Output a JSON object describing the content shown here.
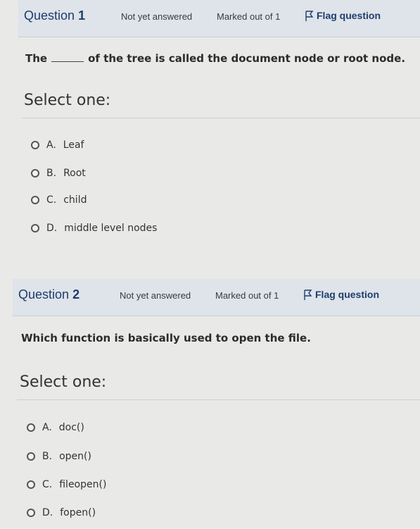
{
  "questions": [
    {
      "number_prefix": "Question",
      "number": "1",
      "status": "Not yet answered",
      "marks": "Marked out of 1",
      "flag_label": "Flag question",
      "text_before": "The",
      "text_after": "of the tree is called the document node or root node.",
      "select_label": "Select one:",
      "options": [
        {
          "letter": "A.",
          "text": "Leaf"
        },
        {
          "letter": "B.",
          "text": "Root"
        },
        {
          "letter": "C.",
          "text": "child"
        },
        {
          "letter": "D.",
          "text": "middle level nodes"
        }
      ]
    },
    {
      "number_prefix": "Question",
      "number": "2",
      "status": "Not yet answered",
      "marks": "Marked out of 1",
      "flag_label": "Flag question",
      "text": "Which function is basically used to open the file.",
      "select_label": "Select one:",
      "options": [
        {
          "letter": "A.",
          "text": "doc()"
        },
        {
          "letter": "B.",
          "text": "open()"
        },
        {
          "letter": "C.",
          "text": "fileopen()"
        },
        {
          "letter": "D.",
          "text": "fopen()"
        }
      ]
    }
  ]
}
